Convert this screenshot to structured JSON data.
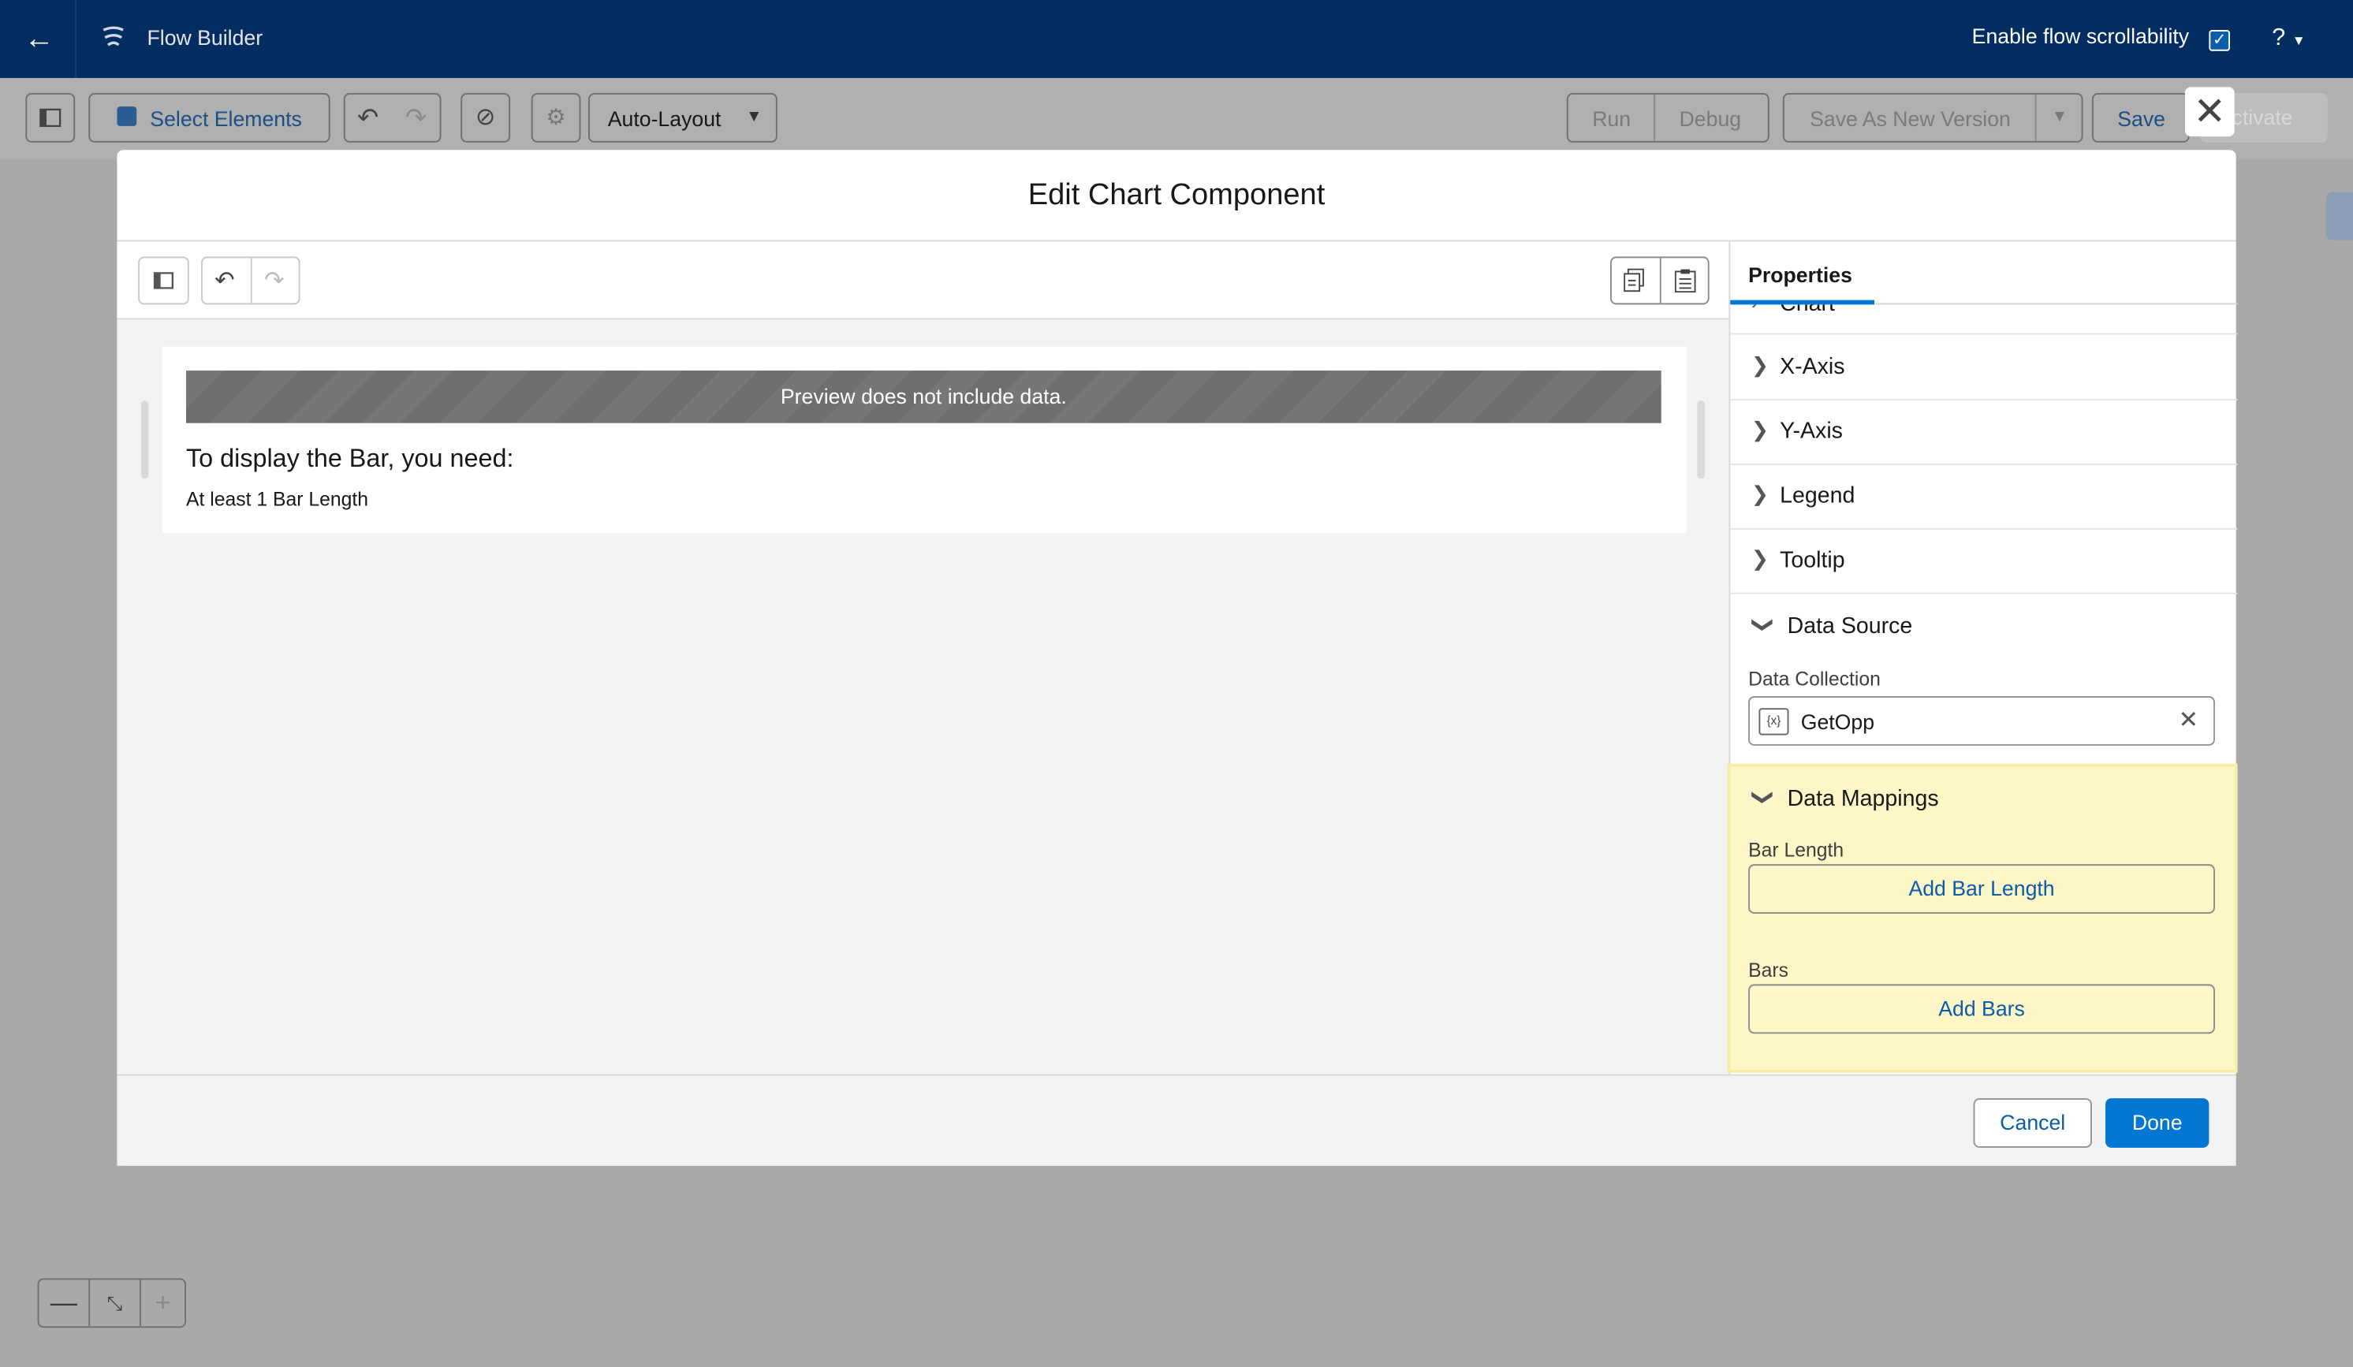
{
  "app": {
    "title": "Flow Builder",
    "scroll_label": "Enable flow scrollability",
    "help": "?"
  },
  "toolbar": {
    "select_elements": "Select Elements",
    "layout": "Auto-Layout",
    "run": "Run",
    "debug": "Debug",
    "save_as_new": "Save As New Version",
    "save": "Save",
    "activate": "Activate"
  },
  "modal": {
    "title": "Edit Chart Component",
    "preview_banner": "Preview does not include data.",
    "preview_heading": "To display the Bar, you need:",
    "preview_sub": "At least 1 Bar Length",
    "properties_tab": "Properties",
    "sections": [
      {
        "label": "Chart",
        "expanded": false
      },
      {
        "label": "X-Axis",
        "expanded": false
      },
      {
        "label": "Y-Axis",
        "expanded": false
      },
      {
        "label": "Legend",
        "expanded": false
      },
      {
        "label": "Tooltip",
        "expanded": false
      },
      {
        "label": "Data Source",
        "expanded": true
      },
      {
        "label": "Data Mappings",
        "expanded": true
      }
    ],
    "data_collection_label": "Data Collection",
    "data_collection_value": "GetOpp",
    "bar_length_label": "Bar Length",
    "add_bar_length": "Add Bar Length",
    "bars_label": "Bars",
    "add_bars": "Add Bars",
    "cancel": "Cancel",
    "done": "Done"
  },
  "colors": {
    "header_bg": "#032d60",
    "brand": "#0176d3",
    "highlight": "#fdf6c7"
  }
}
